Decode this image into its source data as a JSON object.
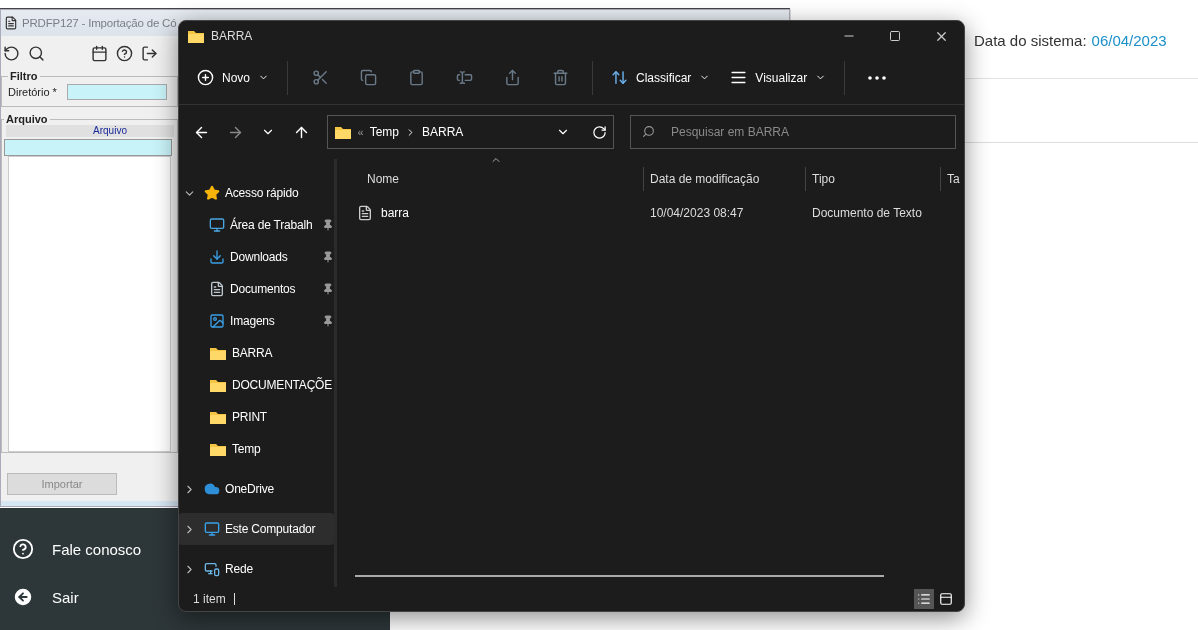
{
  "background_app": {
    "title": "PRDFP127 - Importação de Có",
    "filter": {
      "heading": "Filtro",
      "label": "Diretório *"
    },
    "file_section": {
      "heading": "Arquivo",
      "column": "Arquivo"
    },
    "import_button": {
      "label": "Importar",
      "disabled": true
    }
  },
  "system_date": {
    "label": "Data do sistema:",
    "value": "06/04/2023"
  },
  "side_menu": [
    {
      "kind": "help",
      "label": "Fale conosco"
    },
    {
      "kind": "exit",
      "label": "Sair"
    }
  ],
  "explorer": {
    "title": "BARRA",
    "toolbar": [
      {
        "kind": "new",
        "label": "Novo",
        "disabled": false
      },
      {
        "kind": "cut",
        "disabled": true
      },
      {
        "kind": "copy",
        "disabled": true
      },
      {
        "kind": "paste",
        "disabled": true
      },
      {
        "kind": "rename",
        "disabled": true
      },
      {
        "kind": "share",
        "disabled": true
      },
      {
        "kind": "delete",
        "disabled": true
      },
      {
        "kind": "sort",
        "label": "Classificar",
        "disabled": false
      },
      {
        "kind": "view",
        "label": "Visualizar",
        "disabled": false
      },
      {
        "kind": "more",
        "disabled": false
      }
    ],
    "address": {
      "overflow": "«",
      "segments": [
        "Temp",
        "BARRA"
      ]
    },
    "search": {
      "placeholder": "Pesquisar em BARRA"
    },
    "nav": [
      {
        "kind": "star",
        "label": "Acesso rápido",
        "expanded": true,
        "selected": false,
        "children": [
          {
            "kind": "desktop",
            "label": "Área de Trabalh",
            "pinned": true,
            "selected": false
          },
          {
            "kind": "download",
            "label": "Downloads",
            "pinned": true,
            "selected": false
          },
          {
            "kind": "document",
            "label": "Documentos",
            "pinned": true,
            "selected": false
          },
          {
            "kind": "picture",
            "label": "Imagens",
            "pinned": true,
            "selected": false
          },
          {
            "kind": "folder",
            "label": "BARRA",
            "pinned": false,
            "selected": false
          },
          {
            "kind": "folder",
            "label": "DOCUMENTAÇÕE",
            "pinned": false,
            "selected": false
          },
          {
            "kind": "folder",
            "label": "PRINT",
            "pinned": false,
            "selected": false
          },
          {
            "kind": "folder",
            "label": "Temp",
            "pinned": false,
            "selected": false
          }
        ]
      },
      {
        "kind": "cloud",
        "label": "OneDrive",
        "expanded": false,
        "selected": false
      },
      {
        "kind": "computer",
        "label": "Este Computador",
        "expanded": false,
        "selected": true
      },
      {
        "kind": "network",
        "label": "Rede",
        "expanded": false,
        "selected": false
      }
    ],
    "columns": [
      {
        "label": "Nome",
        "sorted": true
      },
      {
        "label": "Data de modificação",
        "sorted": false
      },
      {
        "label": "Tipo",
        "sorted": false
      },
      {
        "label": "Ta",
        "sorted": false
      }
    ],
    "files": [
      {
        "name": "barra",
        "modified": "10/04/2023 08:47",
        "type": "Documento de Texto"
      }
    ],
    "status": "1 item",
    "views": [
      {
        "kind": "details",
        "selected": true
      },
      {
        "kind": "tiles",
        "selected": false
      }
    ]
  }
}
